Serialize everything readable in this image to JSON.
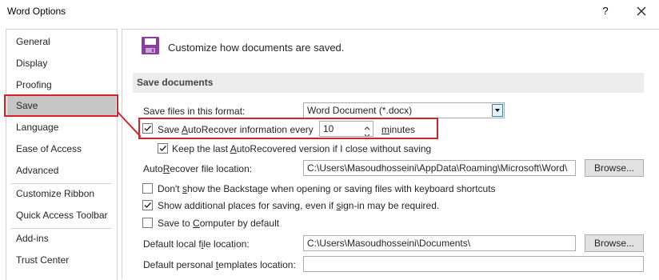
{
  "window": {
    "title": "Word Options",
    "help_label": "?",
    "close_label": "✕"
  },
  "sidebar": {
    "items": [
      {
        "label": "General"
      },
      {
        "label": "Display"
      },
      {
        "label": "Proofing"
      },
      {
        "label": "Save"
      },
      {
        "label": "Language"
      },
      {
        "label": "Ease of Access"
      },
      {
        "label": "Advanced"
      },
      {
        "label": "Customize Ribbon"
      },
      {
        "label": "Quick Access Toolbar"
      },
      {
        "label": "Add-ins"
      },
      {
        "label": "Trust Center"
      }
    ],
    "selected": "Save"
  },
  "main": {
    "header": "Customize how documents are saved.",
    "section_title": "Save documents",
    "format_label": "Save files in this format:",
    "format_value": "Word Document (*.docx)",
    "autorecover": {
      "label_pre": "Save ",
      "label_u": "A",
      "label_post": "utoRecover information every",
      "checked": true,
      "minutes_value": "10",
      "minutes_pre": "",
      "minutes_u": "m",
      "minutes_post": "inutes"
    },
    "keep_last": {
      "label_pre": "Keep the last ",
      "label_u": "A",
      "label_post": "utoRecovered version if I close without saving",
      "checked": true
    },
    "ar_location": {
      "label_pre": "Auto",
      "label_u": "R",
      "label_post": "ecover file location:",
      "value": "C:\\Users\\Masoudhosseini\\AppData\\Roaming\\Microsoft\\Word\\",
      "browse": "Browse..."
    },
    "backstage": {
      "label_pre": "Don't ",
      "label_u": "s",
      "label_post": "how the Backstage when opening or saving files with keyboard shortcuts",
      "checked": false
    },
    "additional": {
      "label_pre": "Show additional places for saving, even if ",
      "label_u": "s",
      "label_post": "ign-in may be required.",
      "checked": true
    },
    "computer": {
      "label_pre": "Save to ",
      "label_u": "C",
      "label_post": "omputer by default",
      "checked": false
    },
    "local_location": {
      "label_pre": "Default local f",
      "label_u": "i",
      "label_post": "le location:",
      "value": "C:\\Users\\Masoudhosseini\\Documents\\",
      "browse": "Browse..."
    },
    "templates_location": {
      "label_pre": "Default personal ",
      "label_u": "t",
      "label_post": "emplates location:",
      "value": ""
    }
  },
  "colors": {
    "highlight_red": "#d2232a",
    "selected_bg": "#c6c6c6",
    "save_icon_purple": "#8a3e9e"
  }
}
